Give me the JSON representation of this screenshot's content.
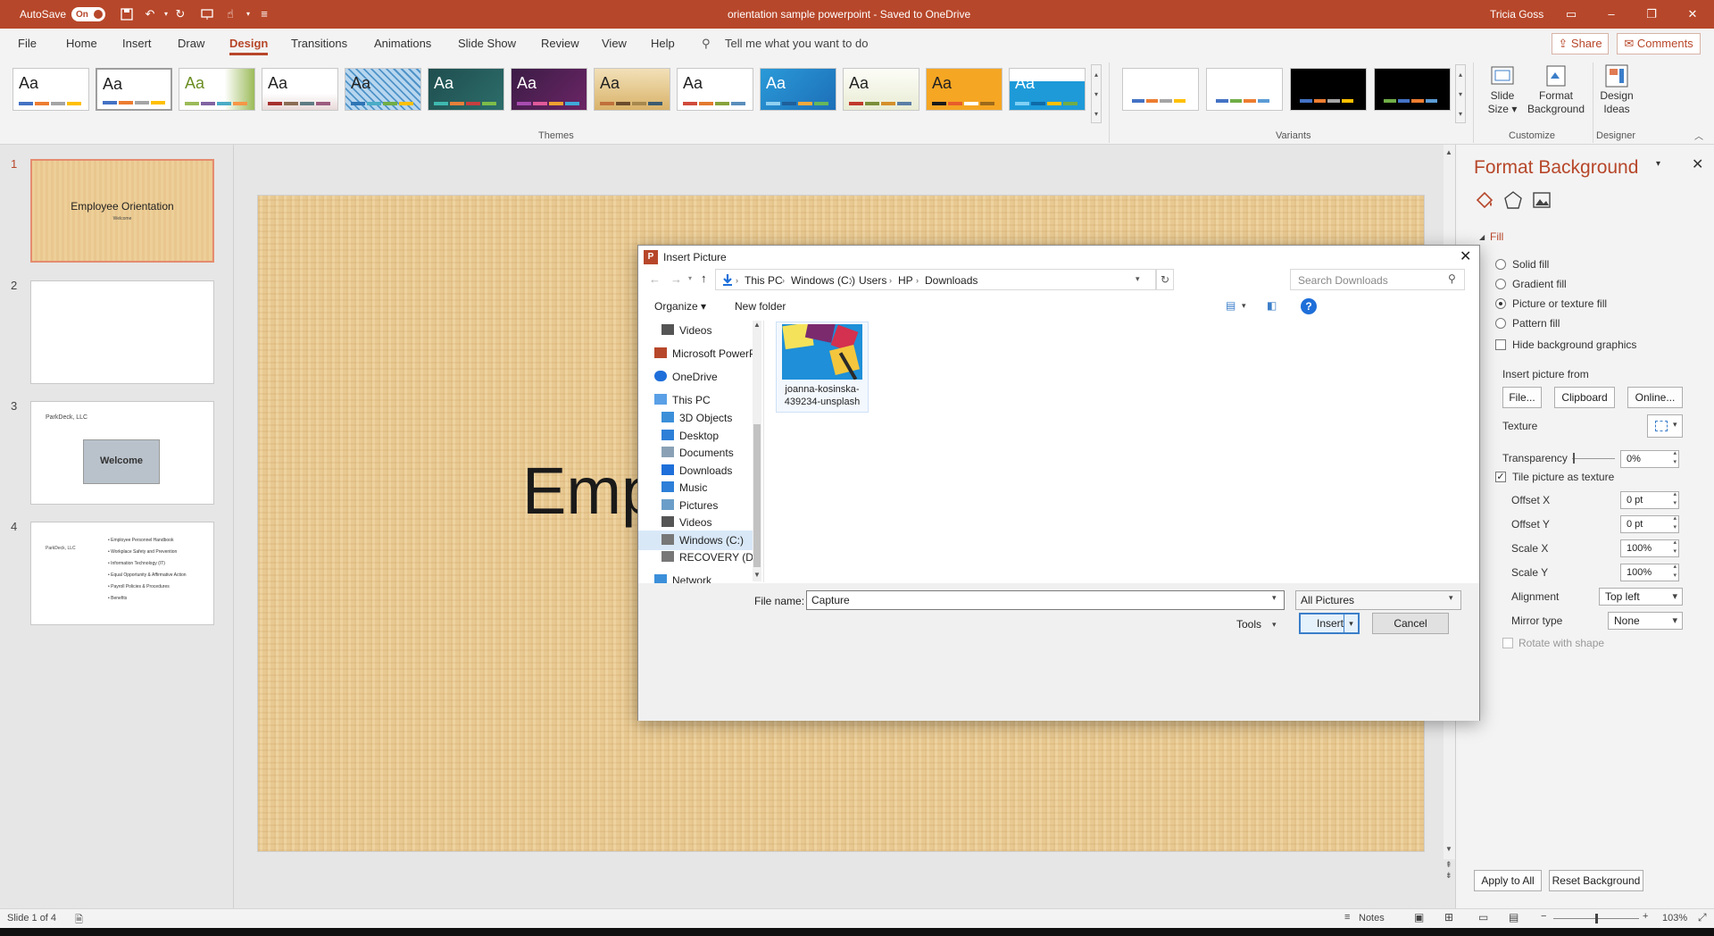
{
  "titlebar": {
    "autosave_label": "AutoSave",
    "autosave_state": "On",
    "doc_title": "orientation sample powerpoint  -  Saved to OneDrive",
    "user": "Tricia Goss",
    "accent": "#b7472a"
  },
  "menu": {
    "tabs": [
      "File",
      "Home",
      "Insert",
      "Draw",
      "Design",
      "Transitions",
      "Animations",
      "Slide Show",
      "Review",
      "View",
      "Help"
    ],
    "active": "Design",
    "tell_me": "Tell me what you want to do",
    "share": "Share",
    "comments": "Comments"
  },
  "ribbon": {
    "themes_label": "Themes",
    "variants_label": "Variants",
    "customize_label": "Customize",
    "designer_label": "Designer",
    "theme_sample": "Aa",
    "slide_size": [
      "Slide",
      "Size ▾"
    ],
    "format_background": [
      "Format",
      "Background"
    ],
    "design_ideas": [
      "Design",
      "Ideas"
    ]
  },
  "slides": {
    "numbers": [
      "1",
      "2",
      "3",
      "4"
    ],
    "s1_title": "Employee Orientation",
    "s1_sub": "Welcome",
    "s3_company": "ParkDeck, LLC",
    "s3_image_text": "Welcome",
    "s4_company": "ParkDeck, LLC",
    "s4_bullets": [
      "Employee Personnel Handbook",
      "Workplace Safety and Prevention",
      "Information Technology (IT)",
      "Equal Opportunity & Affirmative Action",
      "Payroll Policies & Procedures",
      "Benefits"
    ]
  },
  "main_slide": {
    "title_visible": "Emp"
  },
  "dialog": {
    "title": "Insert Picture",
    "breadcrumb": [
      "This PC",
      "Windows (C:)",
      "Users",
      "HP",
      "Downloads"
    ],
    "search_placeholder": "Search Downloads",
    "organize": "Organize ▾",
    "new_folder": "New folder",
    "nav": [
      "Videos",
      "Microsoft PowerP",
      "OneDrive",
      "This PC",
      "3D Objects",
      "Desktop",
      "Documents",
      "Downloads",
      "Music",
      "Pictures",
      "Videos",
      "Windows (C:)",
      "RECOVERY (D:)",
      "Network"
    ],
    "file_name_line1": "joanna-kosinska-",
    "file_name_line2": "439234-unsplash",
    "file_name_label": "File name:",
    "file_name_value": "Capture",
    "filter": "All Pictures",
    "tools": "Tools",
    "insert": "Insert",
    "cancel": "Cancel"
  },
  "format_pane": {
    "title": "Format Background",
    "fill_header": "Fill",
    "fill_options": [
      "Solid fill",
      "Gradient fill",
      "Picture or texture fill",
      "Pattern fill"
    ],
    "selected_fill": "Picture or texture fill",
    "hide_bg": "Hide background graphics",
    "insert_from": "Insert picture from",
    "file_btn": "File...",
    "clipboard_btn": "Clipboard",
    "online_btn": "Online...",
    "texture": "Texture",
    "transparency_label": "Transparency",
    "transparency_value": "0%",
    "tile_label": "Tile picture as texture",
    "tile_checked": true,
    "offset_x_label": "Offset X",
    "offset_x": "0 pt",
    "offset_y_label": "Offset Y",
    "offset_y": "0 pt",
    "scale_x_label": "Scale X",
    "scale_x": "100%",
    "scale_y_label": "Scale Y",
    "scale_y": "100%",
    "alignment_label": "Alignment",
    "alignment": "Top left",
    "mirror_label": "Mirror type",
    "mirror": "None",
    "rotate_label": "Rotate with shape",
    "apply_all": "Apply to All",
    "reset_bg": "Reset Background"
  },
  "status": {
    "slide_info": "Slide 1 of 4",
    "notes": "Notes",
    "zoom": "103%"
  }
}
